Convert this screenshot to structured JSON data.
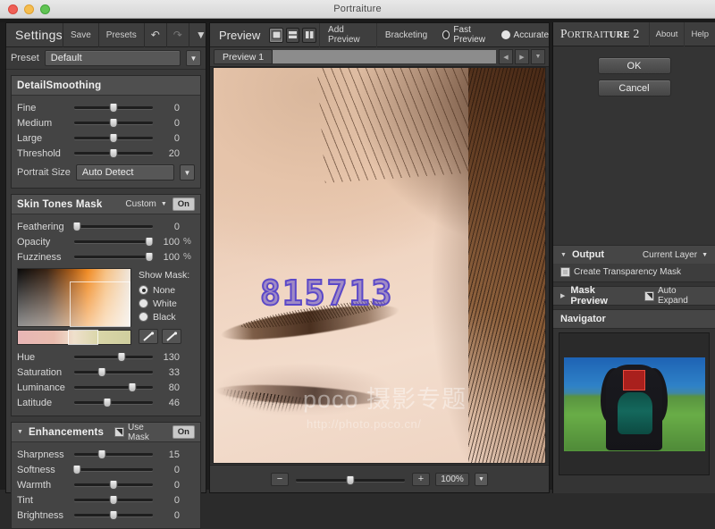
{
  "window": {
    "title": "Portraiture"
  },
  "settings": {
    "title": "Settings",
    "save_label": "Save",
    "presets_label": "Presets",
    "undo_icon": "undo-icon",
    "redo_icon": "redo-icon",
    "menu_icon": "chevron-down-icon",
    "preset_label": "Preset",
    "preset_value": "Default",
    "detail": {
      "title": "DetailSmoothing",
      "sliders": [
        {
          "name": "Fine",
          "value": "0",
          "pct": 50
        },
        {
          "name": "Medium",
          "value": "0",
          "pct": 50
        },
        {
          "name": "Large",
          "value": "0",
          "pct": 50
        },
        {
          "name": "Threshold",
          "value": "20",
          "pct": 50
        }
      ],
      "portrait_size_label": "Portrait Size",
      "portrait_size_value": "Auto Detect"
    },
    "skin": {
      "title": "Skin Tones Mask",
      "mode": "Custom",
      "on_label": "On",
      "sliders": [
        {
          "name": "Feathering",
          "value": "0",
          "unit": "",
          "pct": 4
        },
        {
          "name": "Opacity",
          "value": "100",
          "unit": "%",
          "pct": 92
        },
        {
          "name": "Fuzziness",
          "value": "100",
          "unit": "%",
          "pct": 92
        }
      ],
      "show_mask_label": "Show Mask:",
      "show_mask_options": [
        "None",
        "White",
        "Black"
      ],
      "show_mask_selected": "None",
      "dropper_plus_icon": "eyedropper-plus-icon",
      "dropper_minus_icon": "eyedropper-minus-icon",
      "hsl": [
        {
          "name": "Hue",
          "value": "130",
          "pct": 60
        },
        {
          "name": "Saturation",
          "value": "33",
          "pct": 36
        },
        {
          "name": "Luminance",
          "value": "80",
          "pct": 72
        },
        {
          "name": "Latitude",
          "value": "46",
          "pct": 42
        }
      ]
    },
    "enhancements": {
      "title": "Enhancements",
      "use_mask_label": "Use Mask",
      "on_label": "On",
      "sliders": [
        {
          "name": "Sharpness",
          "value": "15",
          "pct": 36
        },
        {
          "name": "Softness",
          "value": "0",
          "pct": 4
        },
        {
          "name": "Warmth",
          "value": "0",
          "pct": 50
        },
        {
          "name": "Tint",
          "value": "0",
          "pct": 50
        },
        {
          "name": "Brightness",
          "value": "0",
          "pct": 50
        }
      ]
    }
  },
  "preview": {
    "title": "Preview",
    "view_single_icon": "view-single-icon",
    "view_split_h_icon": "view-split-horizontal-icon",
    "view_split_v_icon": "view-split-vertical-icon",
    "add_preview_label": "Add Preview",
    "bracketing_label": "Bracketing",
    "fast_preview_label": "Fast Preview",
    "accurate_label": "Accurate",
    "quality_selected": "Fast Preview",
    "tab_label": "Preview 1",
    "prev_icon": "arrow-left-icon",
    "next_icon": "arrow-right-icon",
    "tab_menu_icon": "chevron-down-icon",
    "watermark_number": "815713",
    "watermark_brand": "poco 摄影专题",
    "watermark_url": "http://photo.poco.cn/",
    "zoom_out_label": "−",
    "zoom_in_label": "+",
    "zoom_value": "100%",
    "zoom_pct": 50,
    "zoom_menu_icon": "chevron-down-icon"
  },
  "right": {
    "brand_part1": "P",
    "brand_part2": "ORTRAIT",
    "brand_part3": "URE",
    "brand_part4": " 2",
    "about_label": "About",
    "help_label": "Help",
    "ok_label": "OK",
    "cancel_label": "Cancel",
    "output": {
      "title": "Output",
      "target": "Current Layer",
      "transparency_label": "Create Transparency Mask"
    },
    "mask_preview": {
      "title": "Mask Preview",
      "auto_expand_label": "Auto Expand"
    },
    "navigator": {
      "title": "Navigator"
    }
  },
  "colors": {
    "panel_bg": "#3a3a3a",
    "section_bg": "#444444",
    "text": "#e6e6e6",
    "watermark_number": "#5b48c8",
    "nav_crop": "#d2231e"
  }
}
